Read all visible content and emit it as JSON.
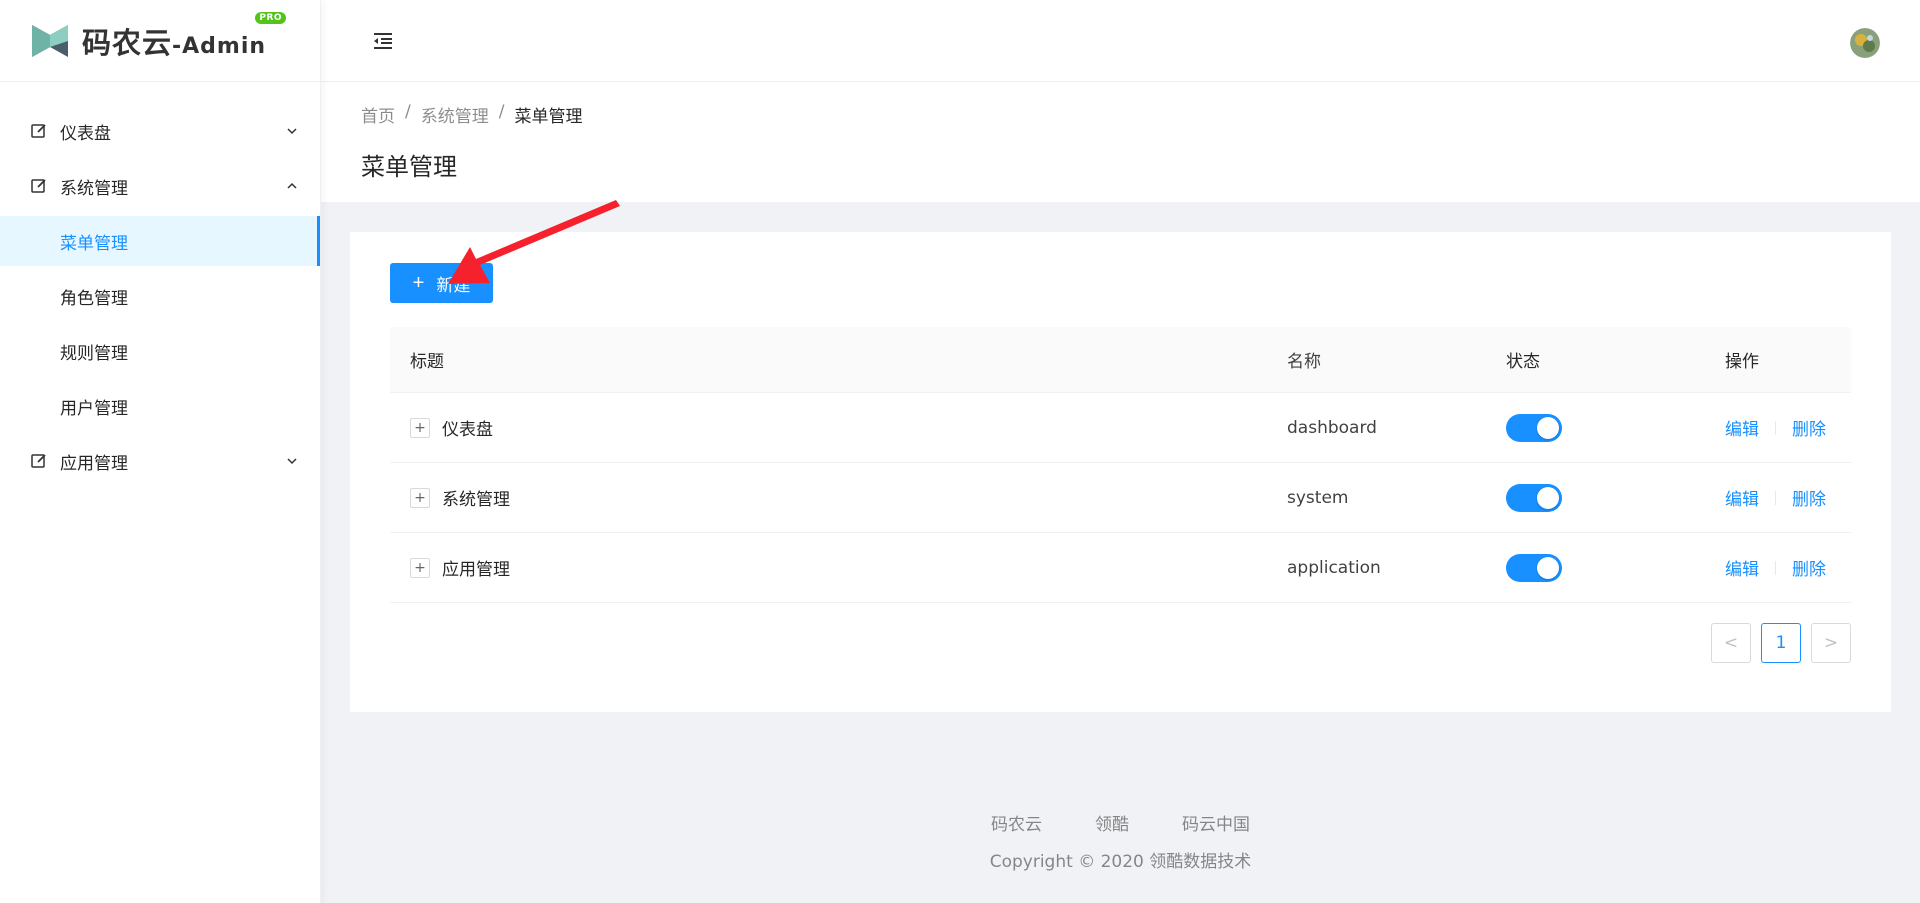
{
  "app": {
    "logo_text": "码农云",
    "logo_suffix": "-Admin",
    "logo_badge": "PRO"
  },
  "sidebar": {
    "items": [
      {
        "label": "仪表盘",
        "icon": "edit-icon",
        "expanded": false
      },
      {
        "label": "系统管理",
        "icon": "edit-icon",
        "expanded": true,
        "children": [
          "菜单管理",
          "角色管理",
          "规则管理",
          "用户管理"
        ]
      },
      {
        "label": "应用管理",
        "icon": "edit-icon",
        "expanded": false
      }
    ],
    "active_child": "菜单管理"
  },
  "breadcrumb": {
    "home": "首页",
    "parent": "系统管理",
    "current": "菜单管理"
  },
  "page": {
    "title": "菜单管理"
  },
  "toolbar": {
    "new_label": "新建"
  },
  "table": {
    "headers": {
      "title": "标题",
      "name": "名称",
      "status": "状态",
      "action": "操作"
    },
    "rows": [
      {
        "title": "仪表盘",
        "name": "dashboard",
        "status": true,
        "edit": "编辑",
        "delete": "删除"
      },
      {
        "title": "系统管理",
        "name": "system",
        "status": true,
        "edit": "编辑",
        "delete": "删除"
      },
      {
        "title": "应用管理",
        "name": "application",
        "status": true,
        "edit": "编辑",
        "delete": "删除"
      }
    ]
  },
  "pagination": {
    "current": "1",
    "prev": "<",
    "next": ">"
  },
  "footer": {
    "links": [
      "码农云",
      "领酷",
      "码云中国"
    ],
    "copyright": "Copyright © 2020 领酷数据技术"
  },
  "colors": {
    "primary": "#1890ff",
    "annotation_arrow": "#f5222d"
  }
}
